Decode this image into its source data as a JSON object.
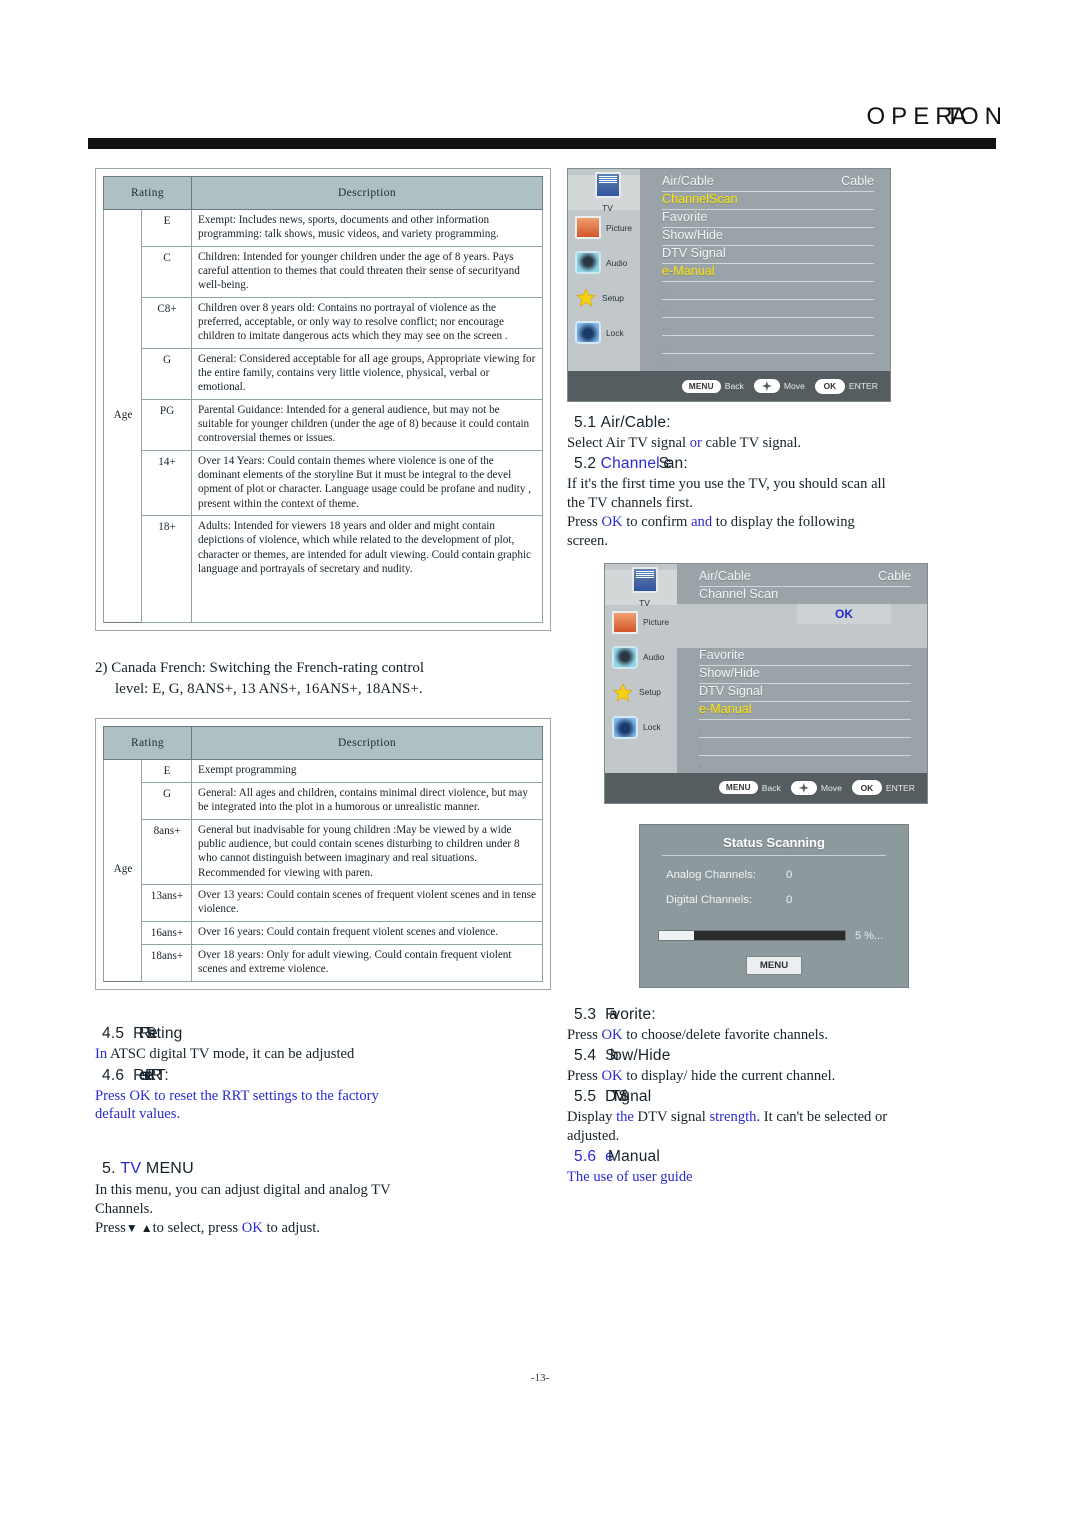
{
  "header": {
    "title_pre": "OPE",
    "title_squish": "RTA",
    "title_post": "ON"
  },
  "page_number": "-13-",
  "table1": {
    "columns": [
      "Rating",
      "Description"
    ],
    "age_label": "Age",
    "rows": [
      {
        "rating": "E",
        "desc": "Exempt: Includes news, sports, documents and other information programming: talk shows, music videos, and variety programming."
      },
      {
        "rating": "C",
        "desc": "Children: Intended for younger children under the age of 8 years. Pays careful attention to themes that could threaten their sense of securityand well-being."
      },
      {
        "rating": "C8+",
        "desc": "Children over 8 years old: Contains no portrayal of violence as the preferred, acceptable, or only way to resolve conflict; nor encourage children to imitate dangerous acts which they may see on the screen ."
      },
      {
        "rating": "G",
        "desc": "General: Considered acceptable for all age groups, Appropriate viewing for the entire family, contains very little violence, physical, verbal or emotional."
      },
      {
        "rating": "PG",
        "desc": "Parental Guidance: Intended for a general audience, but may not be suitable for younger children (under the age of 8) because it could contain controversial themes or issues."
      },
      {
        "rating": "14+",
        "desc": "Over 14 Years: Could contain themes where violence is one of the dominant elements of the storyline But it must be integral to the devel opment of plot or character. Language usage could be profane and nudity , present within the context of theme."
      },
      {
        "rating": "18+",
        "desc": "Adults: Intended for viewers 18 years and older and might contain depictions of  violence, which while related to the development of plot,  character or themes, are intended for adult  viewing. Could contain graphic language and portrayals of secretary and nudity."
      }
    ]
  },
  "midtext": {
    "line1": "2) Canada French: Switching the French-rating control",
    "line2": "level: E, G, 8ANS+, 13 ANS+, 16ANS+, 18ANS+."
  },
  "table2": {
    "columns": [
      "Rating",
      "Description"
    ],
    "age_label": "Age",
    "rows": [
      {
        "rating": "E",
        "desc": "Exempt programming"
      },
      {
        "rating": "G",
        "desc": "General: All ages and children, contains minimal direct violence, but may be integrated into the plot in a humorous or unrealistic manner."
      },
      {
        "rating": "8ans+",
        "desc": "General but inadvisable for young children :May be viewed by a wide public audience, but could contain scenes disturbing to children under 8 who cannot distinguish between imaginary and real situations. Recommended for viewing with paren."
      },
      {
        "rating": "13ans+",
        "desc": "Over 13 years: Could contain scenes of frequent violent scenes and in tense violence."
      },
      {
        "rating": "16ans+",
        "desc": "Over 16 years: Could contain frequent violent scenes and violence."
      },
      {
        "rating": "18ans+",
        "desc": "Over 18 years: Only for adult viewing. Could contain frequent violent  scenes and extreme violence."
      }
    ]
  },
  "left_sections": {
    "s45_num": "4.5",
    "s45_title_a": "RR",
    "s45_title_b": "T se",
    "s45_title_c": "tting",
    "s45_body_blue": "In",
    "s45_body_rest": " ATSC digital TV mode, it can be adjusted",
    "s46_num": "4.6",
    "s46_title_a": "Re",
    "s46_title_b": "set  RR",
    "s46_title_c": "T:",
    "s46_body_1": "Press ",
    "s46_body_ok": "OK",
    "s46_body_2": " to reset the RRT settings to the factory",
    "s46_body_3": "default values.",
    "s5_num": "5.",
    "s5_tv": "TV",
    "s5_menu": " MENU",
    "s5_body_1": "In this menu, you can adjust digital and analog TV",
    "s5_body_2": "Channels.",
    "s5_body_3a": "Press",
    "s5_body_arrows": "▼ ▲",
    "s5_body_3b": "to select, press ",
    "s5_body_ok": "OK",
    "s5_body_3c": " to adjust."
  },
  "osd1": {
    "sidebar": [
      {
        "icon": "tv-icon",
        "label": "TV"
      },
      {
        "icon": "picture-icon",
        "label": "Picture"
      },
      {
        "icon": "audio-icon",
        "label": "Audio"
      },
      {
        "icon": "setup-icon",
        "label": "Setup"
      },
      {
        "icon": "lock-icon",
        "label": "Lock"
      }
    ],
    "rows": [
      {
        "label": "Air/Cable",
        "value": "Cable",
        "selected": false
      },
      {
        "label": "ChannelScan",
        "value": "",
        "selected": true
      },
      {
        "label": "Favorite",
        "value": "",
        "selected": false
      },
      {
        "label": "Show/Hide",
        "value": "",
        "selected": false
      },
      {
        "label": "DTV Signal",
        "value": "",
        "selected": false
      },
      {
        "label": "e-Manual",
        "value": "",
        "selected": true
      }
    ],
    "footer": {
      "menu": "MENU",
      "menu_label": "Back",
      "move_label": "Move",
      "ok": "OK",
      "enter_label": "ENTER"
    }
  },
  "osd2": {
    "sidebar": [
      {
        "icon": "tv-icon",
        "label": "TV"
      },
      {
        "icon": "picture-icon",
        "label": "Picture"
      },
      {
        "icon": "audio-icon",
        "label": "Audio"
      },
      {
        "icon": "setup-icon",
        "label": "Setup"
      },
      {
        "icon": "lock-icon",
        "label": "Lock"
      }
    ],
    "top_rows": [
      {
        "label": "Air/Cable",
        "value": "Cable",
        "selected": false
      },
      {
        "label": "Channel Scan",
        "value": "",
        "selected": false
      }
    ],
    "ok_popup": "OK",
    "rows": [
      {
        "label": "Favorite",
        "value": "",
        "selected": false
      },
      {
        "label": "Show/Hide",
        "value": "",
        "selected": false
      },
      {
        "label": "DTV Signal",
        "value": "",
        "selected": false
      },
      {
        "label": "e-Manual",
        "value": "",
        "selected": true
      }
    ],
    "footer": {
      "menu": "MENU",
      "menu_label": "Back",
      "move_label": "Move",
      "ok": "OK",
      "enter_label": "ENTER"
    }
  },
  "scan_dialog": {
    "title": "Status Scanning",
    "analog_label": "Analog Channels:",
    "analog_value": "0",
    "digital_label": "Digital Channels:",
    "digital_value": "0",
    "progress_pct": 5,
    "progress_text": "5 %...",
    "menu_button": "MENU"
  },
  "right_sections": {
    "s51_num": "5.1",
    "s51_title": "Air/Cable:",
    "s51_b1": "Select Air TV signal ",
    "s51_or": "or",
    "s51_b2": " cable TV signal.",
    "s52_num": "5.2",
    "s52_title_blue": "Channel",
    "s52_title_a": "  Sc",
    "s52_title_b": "an:",
    "s52_b1": "If it's the first time you use the TV, you should scan all",
    "s52_b2": "the TV channels first.",
    "s52_b3a": "Press ",
    "s52_ok": "OK",
    "s52_b3b": " to confirm ",
    "s52_and": "and",
    "s52_b3c": " to display the following",
    "s52_b4": "screen.",
    "s53_num": "5.3",
    "s53_title_a": "Fa",
    "s53_title_b": "vorite:",
    "s53_b1": "Press ",
    "s53_ok": "OK",
    "s53_b2": " to choose/delete  favorite channels.",
    "s54_num": "5.4",
    "s54_title_a": "Sh",
    "s54_title_b": "ow/Hide",
    "s54_b1": "Press ",
    "s54_ok": "OK",
    "s54_b2": " to display/ hide the current channel.",
    "s55_num": "5.5",
    "s55_title_a": "DT",
    "s55_title_b": "V  Si",
    "s55_title_c": "gnal",
    "s55_b1": "Display ",
    "s55_the": "the",
    "s55_b2": " DTV signal ",
    "s55_strength": "strength",
    "s55_b3": ". It can't be selected or",
    "s55_b4": "adjusted.",
    "s56_num": "5.6",
    "s56_title_a": "e-",
    "s56_title_b": "Manual",
    "s56_body": "The use of user guide"
  }
}
